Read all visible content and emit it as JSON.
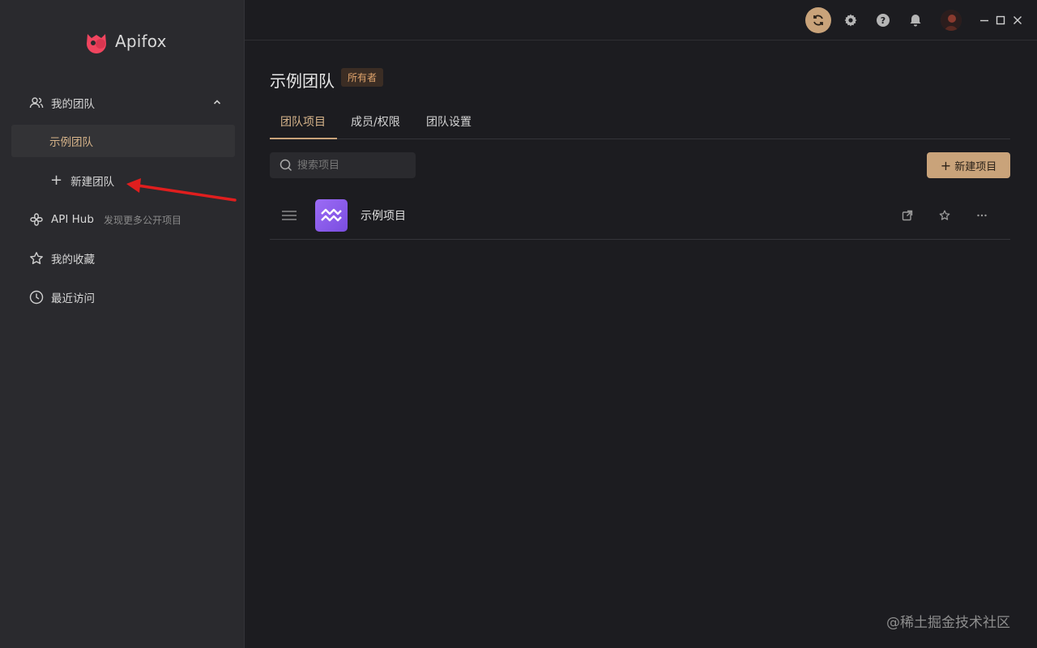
{
  "app": {
    "name": "Apifox"
  },
  "sidebar": {
    "my_team": "我的团队",
    "active_team": "示例团队",
    "new_team": "新建团队",
    "api_hub": "API Hub",
    "api_hub_sub": "发现更多公开项目",
    "favorites": "我的收藏",
    "recent": "最近访问"
  },
  "header": {
    "team_title": "示例团队",
    "owner_badge": "所有者"
  },
  "tabs": [
    {
      "label": "团队项目"
    },
    {
      "label": "成员/权限"
    },
    {
      "label": "团队设置"
    }
  ],
  "search": {
    "placeholder": "搜索项目"
  },
  "actions": {
    "new_project": "新建项目"
  },
  "projects": [
    {
      "name": "示例项目"
    }
  ],
  "watermark": "@稀土掘金技术社区",
  "colors": {
    "accent": "#c9a37a",
    "badge_text": "#e0a46c",
    "project_icon": "#8b5cf0",
    "arrow": "#e01e1e"
  }
}
